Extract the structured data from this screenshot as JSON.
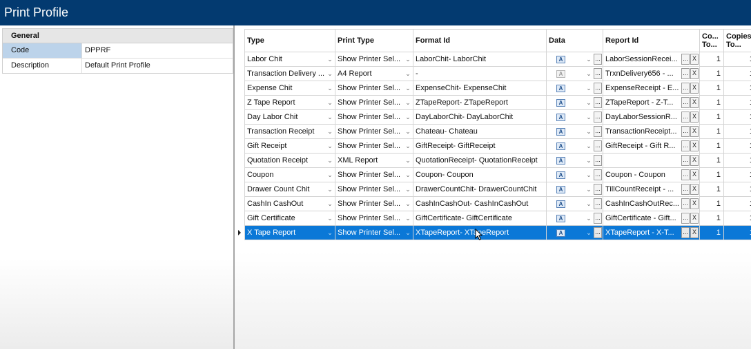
{
  "window": {
    "title": "Print Profile"
  },
  "general": {
    "header": "General",
    "rows": [
      {
        "key": "Code",
        "value": "DPPRF"
      },
      {
        "key": "Description",
        "value": "Default Print Profile"
      }
    ]
  },
  "grid": {
    "columns": {
      "type": "Type",
      "print_type": "Print Type",
      "format_id": "Format Id",
      "data": "Data",
      "report_id": "Report Id",
      "copies_to1": "Co... To...",
      "copies_to2": "Copies To..."
    },
    "button_labels": {
      "ellipsis": "...",
      "clear": "X",
      "data_icon": "A"
    },
    "rows": [
      {
        "type": "Labor Chit",
        "print_type": "Show Printer Sel...",
        "format_id": "LaborChit- LaborChit",
        "report_id": "LaborSessionRecei...",
        "c1": "1",
        "c2": "1"
      },
      {
        "type": "Transaction Delivery ...",
        "print_type": "A4 Report",
        "format_id": "-",
        "report_id": "TrxnDelivery656 - ...",
        "c1": "1",
        "c2": "1"
      },
      {
        "type": "Expense Chit",
        "print_type": "Show Printer Sel...",
        "format_id": "ExpenseChit- ExpenseChit",
        "report_id": "ExpenseReceipt - E...",
        "c1": "1",
        "c2": "1"
      },
      {
        "type": "Z Tape Report",
        "print_type": "Show Printer Sel...",
        "format_id": "ZTapeReport- ZTapeReport",
        "report_id": "ZTapeReport - Z-T...",
        "c1": "1",
        "c2": "1"
      },
      {
        "type": "Day Labor Chit",
        "print_type": "Show Printer Sel...",
        "format_id": "DayLaborChit- DayLaborChit",
        "report_id": "DayLaborSessionR...",
        "c1": "1",
        "c2": "1"
      },
      {
        "type": "Transaction Receipt",
        "print_type": "Show Printer Sel...",
        "format_id": "Chateau- Chateau",
        "report_id": "TransactionReceipt...",
        "c1": "1",
        "c2": "1"
      },
      {
        "type": "Gift Receipt",
        "print_type": "Show Printer Sel...",
        "format_id": "GiftReceipt- GiftReceipt",
        "report_id": "GiftReceipt - Gift R...",
        "c1": "1",
        "c2": "1"
      },
      {
        "type": "Quotation Receipt",
        "print_type": "XML Report",
        "format_id": "QuotationReceipt- QuotationReceipt",
        "report_id": "",
        "c1": "1",
        "c2": "1"
      },
      {
        "type": "Coupon",
        "print_type": "Show Printer Sel...",
        "format_id": "Coupon- Coupon",
        "report_id": "Coupon - Coupon",
        "c1": "1",
        "c2": "1"
      },
      {
        "type": "Drawer Count Chit",
        "print_type": "Show Printer Sel...",
        "format_id": "DrawerCountChit- DrawerCountChit",
        "report_id": "TillCountReceipt - ...",
        "c1": "1",
        "c2": "1"
      },
      {
        "type": "CashIn CashOut",
        "print_type": "Show Printer Sel...",
        "format_id": "CashInCashOut- CashInCashOut",
        "report_id": "CashInCashOutRec...",
        "c1": "1",
        "c2": "1"
      },
      {
        "type": "Gift Certificate",
        "print_type": "Show Printer Sel...",
        "format_id": "GiftCertificate- GiftCertificate",
        "report_id": "GiftCertificate - Gift...",
        "c1": "1",
        "c2": "1"
      },
      {
        "type": "X Tape Report",
        "print_type": "Show Printer Sel...",
        "format_id": "XTapeReport- XTapeReport",
        "report_id": "XTapeReport - X-T...",
        "c1": "1",
        "c2": "1",
        "selected": true
      }
    ]
  },
  "colors": {
    "titlebar": "#033a70",
    "selection": "#0b78d7",
    "prop_selected": "#bcd3ea"
  }
}
